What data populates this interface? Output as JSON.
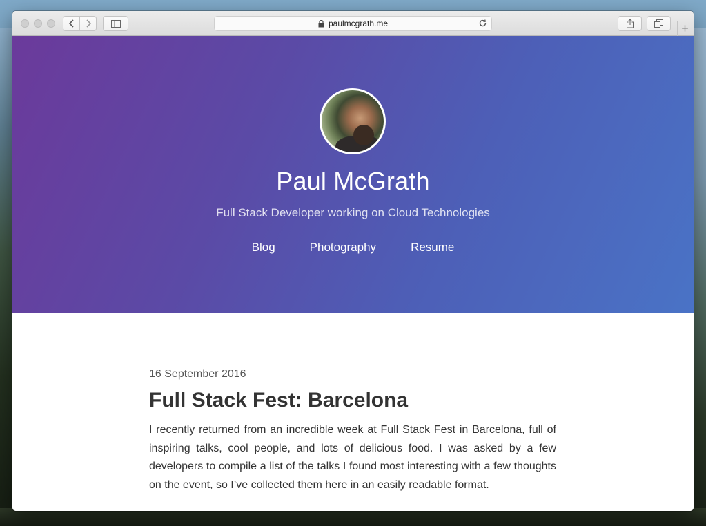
{
  "browser": {
    "url": "paulmcgrath.me",
    "new_tab_symbol": "+"
  },
  "site": {
    "title": "Paul McGrath",
    "subtitle": "Full Stack Developer working on Cloud Technologies",
    "nav": [
      "Blog",
      "Photography",
      "Resume"
    ]
  },
  "post": {
    "date": "16 September 2016",
    "title": "Full Stack Fest: Barcelona",
    "body": "I recently returned from an incredible week at Full Stack Fest in Barcelona, full of inspiring talks, cool people, and lots of delicious food. I was asked by a few developers to compile a list of the talks I found most interesting with a few thoughts on the event, so I’ve collected them here in an easily readable format."
  },
  "colors": {
    "hero_start": "#6b3a9b",
    "hero_end": "#4a73c6"
  },
  "icons": {
    "lock": "lock-icon",
    "reload": "reload-icon",
    "back": "chevron-left-icon",
    "forward": "chevron-right-icon",
    "sidebar": "sidebar-icon",
    "share": "share-icon",
    "tabs": "tabs-overview-icon"
  }
}
